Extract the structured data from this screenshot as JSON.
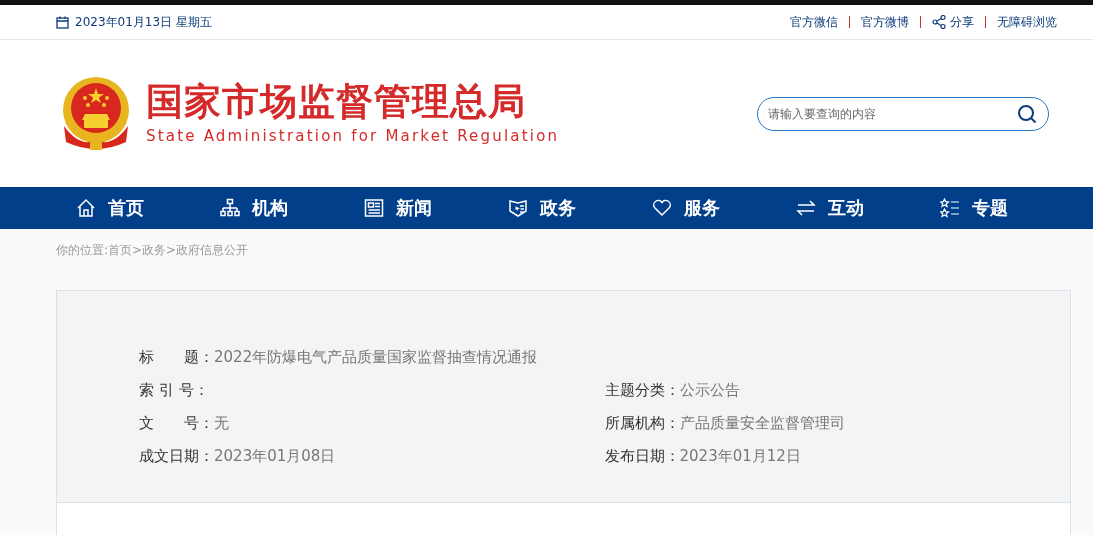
{
  "top_bar": {
    "date": "2023年01月13日 星期五",
    "links": [
      {
        "label": "官方微信",
        "kind": "text"
      },
      {
        "label": "官方微博",
        "kind": "text"
      },
      {
        "label": "分享",
        "kind": "share"
      },
      {
        "label": "无障碍浏览",
        "kind": "text"
      }
    ]
  },
  "header": {
    "title": "国家市场监督管理总局",
    "subtitle": "State Administration for Market Regulation",
    "search": {
      "placeholder": "请输入要查询的内容"
    }
  },
  "nav": [
    {
      "label": "首页",
      "kind": "home"
    },
    {
      "label": "机构",
      "kind": "org"
    },
    {
      "label": "新闻",
      "kind": "news"
    },
    {
      "label": "政务",
      "kind": "gov"
    },
    {
      "label": "服务",
      "kind": "heart"
    },
    {
      "label": "互动",
      "kind": "swap"
    },
    {
      "label": "专题",
      "kind": "stars"
    }
  ],
  "breadcrumb": "你的位置:首页>政务>政府信息公开",
  "info": {
    "title": {
      "label": "标　　题：",
      "value": "2022年防爆电气产品质量国家监督抽查情况通报"
    },
    "rows": [
      [
        {
          "label": "索 引 号："
        },
        {
          "label": "主题分类：",
          "value": "公示公告"
        }
      ],
      [
        {
          "label": "文　　号：",
          "value": "无"
        },
        {
          "label": "所属机构：",
          "value": "产品质量安全监督管理司"
        }
      ],
      [
        {
          "label": "成文日期：",
          "value": "2023年01月08日"
        },
        {
          "label": "发布日期：",
          "value": "2023年01月12日"
        }
      ]
    ]
  }
}
